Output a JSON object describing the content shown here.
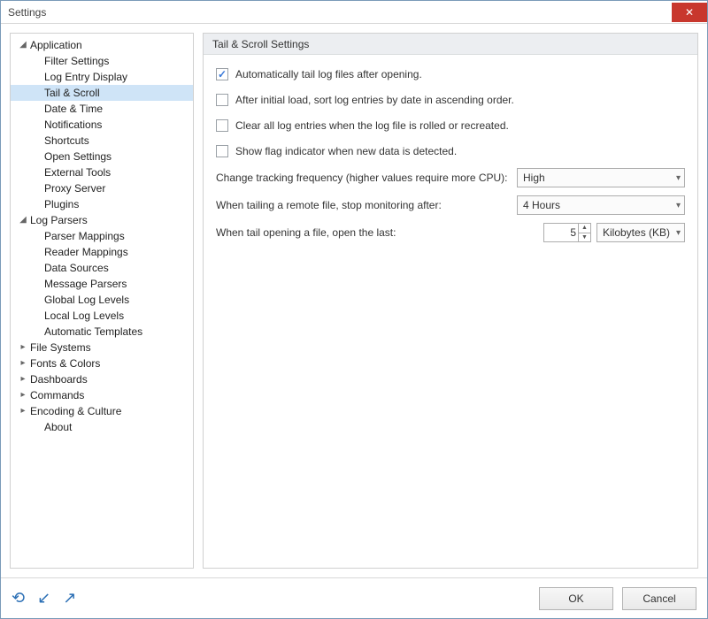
{
  "window": {
    "title": "Settings"
  },
  "nav": {
    "application": {
      "label": "Application",
      "children": {
        "filter_settings": "Filter Settings",
        "log_entry_display": "Log Entry Display",
        "tail_scroll": "Tail & Scroll",
        "date_time": "Date & Time",
        "notifications": "Notifications",
        "shortcuts": "Shortcuts",
        "open_settings": "Open Settings",
        "external_tools": "External Tools",
        "proxy_server": "Proxy Server",
        "plugins": "Plugins"
      }
    },
    "log_parsers": {
      "label": "Log Parsers",
      "children": {
        "parser_mappings": "Parser Mappings",
        "reader_mappings": "Reader Mappings",
        "data_sources": "Data Sources",
        "message_parsers": "Message Parsers",
        "global_log_levels": "Global Log Levels",
        "local_log_levels": "Local Log Levels",
        "automatic_templates": "Automatic Templates"
      }
    },
    "file_systems": "File Systems",
    "fonts_colors": "Fonts & Colors",
    "dashboards": "Dashboards",
    "commands": "Commands",
    "encoding_culture": "Encoding & Culture",
    "about": "About"
  },
  "panel": {
    "header": "Tail & Scroll Settings",
    "opt_auto_tail": "Automatically tail log files after opening.",
    "opt_sort_asc": "After initial load, sort log entries by date in ascending order.",
    "opt_clear_on_roll": "Clear all log entries when the log file is rolled or recreated.",
    "opt_flag_indicator": "Show flag indicator when new data is detected.",
    "tracking_label": "Change tracking frequency (higher values require more CPU):",
    "tracking_value": "High",
    "remote_stop_label": "When tailing a remote file, stop monitoring after:",
    "remote_stop_value": "4 Hours",
    "open_last_label": "When tail opening a file, open the last:",
    "open_last_value": "5",
    "open_last_unit": "Kilobytes (KB)"
  },
  "footer": {
    "ok": "OK",
    "cancel": "Cancel"
  }
}
